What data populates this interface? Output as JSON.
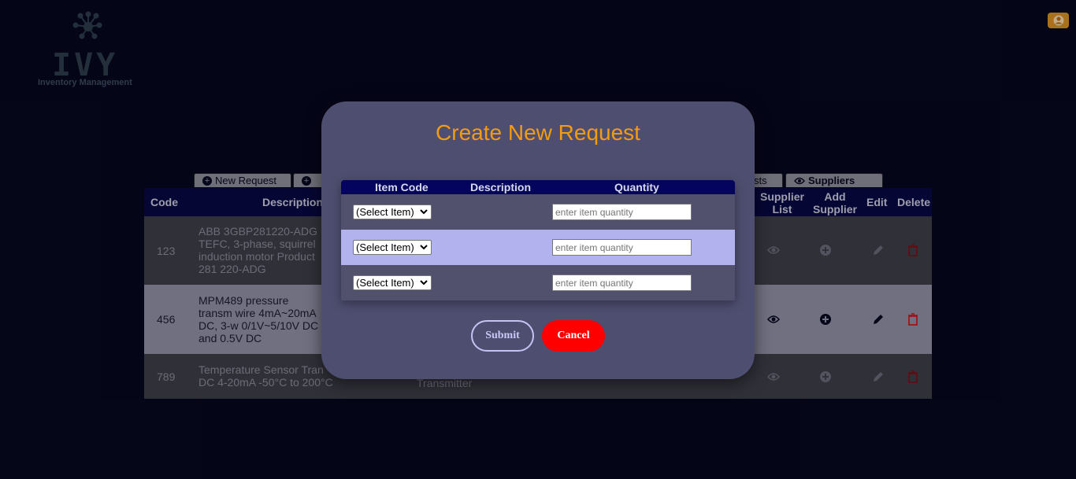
{
  "logo": {
    "word": "IVY",
    "subtitle": "Inventory Management"
  },
  "user_icon": "user-circle-icon",
  "tabs": [
    {
      "label": "New Request",
      "icon": "plus-circle-icon"
    },
    {
      "label": "",
      "icon": "plus-circle-icon"
    },
    {
      "label": "sts"
    },
    {
      "label": "Suppliers",
      "icon": "eye-icon"
    }
  ],
  "table": {
    "headers": {
      "code": "Code",
      "description": "Description",
      "supplier_list": "Supplier List",
      "add_supplier": "Add Supplier",
      "edit": "Edit",
      "delete": "Delete"
    },
    "rows": [
      {
        "code": "123",
        "description": "ABB 3GBP281220-ADG TEFC, 3-phase, squirrel induction motor Product 281 220-ADG"
      },
      {
        "code": "456",
        "description": "MPM489 pressure transm wire 4mA~20mA DC, 3-w 0/1V~5/10V DC and 0.5V DC"
      },
      {
        "code": "789",
        "description": "Temperature Sensor Tran DC 4-20mA -50°C to 200°C",
        "extra": "Transmitter"
      }
    ]
  },
  "modal": {
    "title": "Create New Request",
    "columns": {
      "item_code": "Item Code",
      "description": "Description",
      "quantity": "Quantity"
    },
    "rows": [
      {
        "select_value": "(Select Item)",
        "quantity_placeholder": "enter item quantity"
      },
      {
        "select_value": "(Select Item)",
        "quantity_placeholder": "enter item quantity"
      },
      {
        "select_value": "(Select Item)",
        "quantity_placeholder": "enter item quantity"
      }
    ],
    "submit_label": "Submit",
    "cancel_label": "Cancel"
  },
  "colors": {
    "background": "#06061a",
    "modal": "#4e4e70",
    "title": "#f39c12",
    "header": "#04045e",
    "highlight_row": "#b2b2ee",
    "cancel": "#ff0000"
  }
}
